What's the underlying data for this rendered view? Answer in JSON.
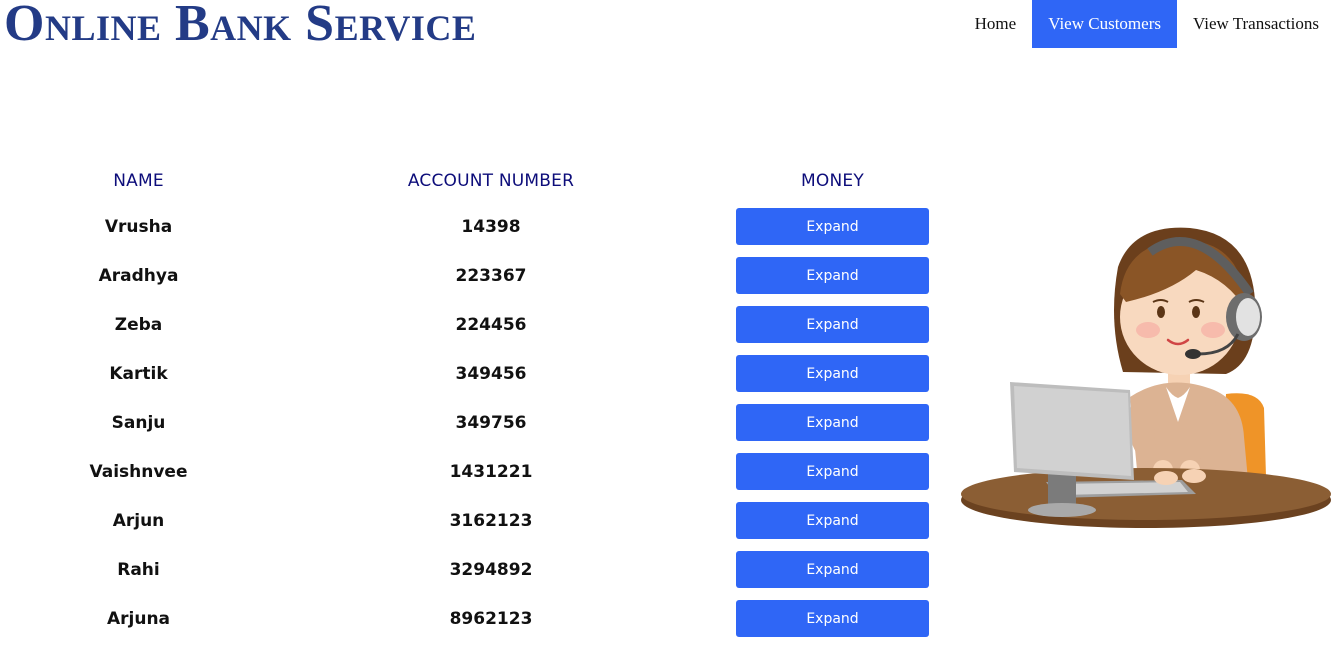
{
  "header": {
    "logo_text": "Online Bank Service",
    "nav": [
      {
        "label": "Home",
        "active": false
      },
      {
        "label": "View Customers",
        "active": true
      },
      {
        "label": "View Transactions",
        "active": false
      }
    ]
  },
  "table": {
    "columns": [
      "NAME",
      "ACCOUNT NUMBER",
      "MONEY"
    ],
    "button_label": "Expand",
    "rows": [
      {
        "name": "Vrusha",
        "account": "14398"
      },
      {
        "name": "Aradhya",
        "account": "223367"
      },
      {
        "name": "Zeba",
        "account": "224456"
      },
      {
        "name": "Kartik",
        "account": "349456"
      },
      {
        "name": "Sanju",
        "account": "349756"
      },
      {
        "name": "Vaishnvee",
        "account": "1431221"
      },
      {
        "name": "Arjun",
        "account": "3162123"
      },
      {
        "name": "Rahi",
        "account": "3294892"
      },
      {
        "name": "Arjuna",
        "account": "8962123"
      }
    ]
  },
  "colors": {
    "accent": "#2f66f6",
    "logo": "#233b86",
    "header_text": "#0d0d7a"
  },
  "illustration": {
    "icon": "customer-support-agent-illustration"
  }
}
